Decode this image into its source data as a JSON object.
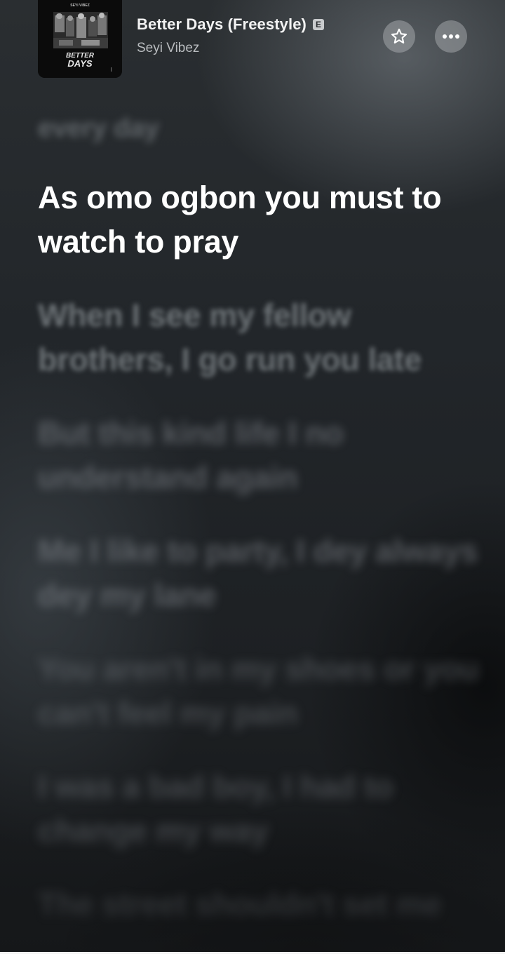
{
  "now_playing": {
    "title": "Better Days (Freestyle)",
    "explicit_badge": "E",
    "artist": "Seyi Vibez",
    "favorite_icon": "star-icon",
    "more_icon": "more-dots-icon"
  },
  "album_art": {
    "top_text": "SEYI VIBEZ",
    "logo_line_1": "BETTER",
    "logo_line_2": "DAYS"
  },
  "lyrics": {
    "previous_line": "every day",
    "current_line": "As omo ogbon you must to watch to pray",
    "upcoming_lines": [
      "When I see my fellow brothers, I go run you late",
      "But this kind life I no understand again",
      "Me I like to party, I dey always dey my lane",
      "You aren't in my shoes or you can't feel my pain",
      "I was a bad boy, I had to change my way",
      "The street shouldn't set me"
    ]
  }
}
